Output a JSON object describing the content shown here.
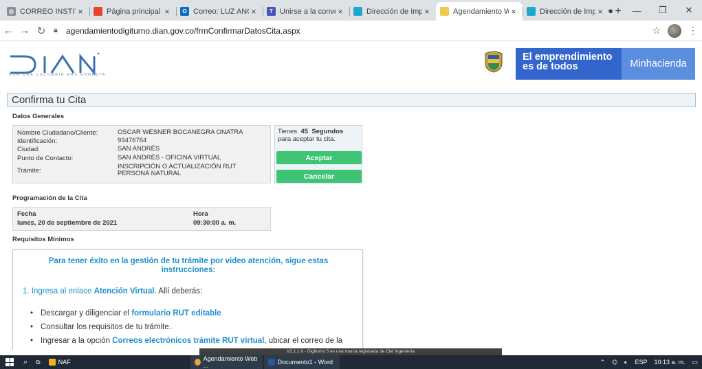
{
  "browser": {
    "tabs": [
      {
        "label": "CORREO INSTITU",
        "fav_color": "#8a8f96",
        "fav_glyph": "◎"
      },
      {
        "label": "Página principal d",
        "fav_color": "#e4452b",
        "fav_glyph": ""
      },
      {
        "label": "Correo: LUZ ANG",
        "fav_color": "#0f6cbd",
        "fav_glyph": "O"
      },
      {
        "label": "Unirse a la conve",
        "fav_color": "#4b53bc",
        "fav_glyph": "T"
      },
      {
        "label": "Dirección de Imp",
        "fav_color": "#1ea7cf",
        "fav_glyph": ""
      },
      {
        "label": "Agendamiento W",
        "fav_color": "#f0c94f",
        "fav_glyph": ""
      },
      {
        "label": "Dirección de Imp",
        "fav_color": "#1ea7cf",
        "fav_glyph": ""
      }
    ],
    "active_tab_index": 5,
    "url": "agendamientodigiturno.dian.gov.co/frmConfirmarDatosCita.aspx"
  },
  "header": {
    "logo_text": "DIAN",
    "slogan": "POR UNA COLOMBIA MÁS HONESTA",
    "banner_line1": "El emprendimiento",
    "banner_line2": "es de todos",
    "banner_right": "Minhacienda"
  },
  "page": {
    "title": "Confirma tu Cita",
    "general_heading": "Datos Generales",
    "general": [
      {
        "key": "Nombre Ciudadano/Cliente:",
        "value": "OSCAR WESNER BOCANEGRA ONATRA"
      },
      {
        "key": "Identificación:",
        "value": "93476764"
      },
      {
        "key": "Ciudad:",
        "value": "SAN ANDRÉS"
      },
      {
        "key": "Punto de Contacto:",
        "value": "SAN ANDRÉS - OFICINA VIRTUAL"
      },
      {
        "key": "Trámite:",
        "value": "INSCRIPCIÓN O ACTUALIZACIÓN RUT PERSONA NATURAL"
      }
    ],
    "timer": {
      "prefix": "Tienes",
      "seconds": "45",
      "unit": "Segundos",
      "suffix": "para aceptar tu cita."
    },
    "accept_label": "Aceptar",
    "cancel_label": "Cancelar",
    "schedule_heading": "Programación de la Cita",
    "date_label": "Fecha",
    "date_value": "lunes, 20 de septiembre de 2021",
    "time_label": "Hora",
    "time_value": "09:30:00 a. m.",
    "requirements_heading": "Requisitos Mínimos",
    "req_intro": "Para tener éxito en la gestión de tu trámite por video atención, sigue estas instrucciones:",
    "step1_prefix": "1. Ingresa al enlace ",
    "step1_link": "Atención Virtual",
    "step1_suffix": ". Allí deberás:",
    "bullet1_prefix": "Descargar y diligenciar el ",
    "bullet1_link": "formulario RUT editable",
    "bullet2": "Consultar los requisitos de tu trámite.",
    "bullet3_prefix": "Ingresar a la opción ",
    "bullet3_link": "Correos electrónicos trámite RUT virtual",
    "bullet3_suffix": ", ubicar el correo de la"
  },
  "footer": "V2.1.1.0 - Digiturno 5 es una marca registrada de Ciel Ingeniería",
  "taskbar": {
    "items": [
      "NAF",
      "Agendamiento Web ...",
      "Documento1 - Word"
    ],
    "lang": "ESP",
    "time": "10:13 a. m."
  }
}
